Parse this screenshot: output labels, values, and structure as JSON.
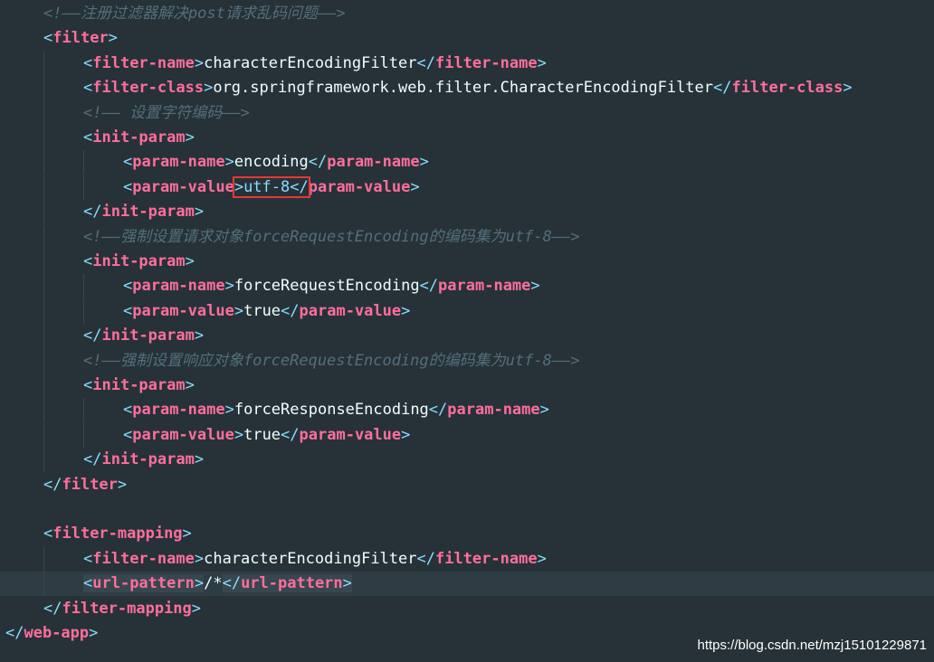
{
  "editor": {
    "lines": [
      {
        "indent": 1,
        "parts": [
          {
            "c": "cmt",
            "t": "<!——注册过滤器解决post请求乱码问题——>"
          }
        ]
      },
      {
        "indent": 1,
        "parts": [
          {
            "c": "br",
            "t": "<"
          },
          {
            "c": "tag",
            "t": "filter"
          },
          {
            "c": "br",
            "t": ">"
          }
        ]
      },
      {
        "indent": 2,
        "parts": [
          {
            "c": "br",
            "t": "<"
          },
          {
            "c": "tag",
            "t": "filter-name"
          },
          {
            "c": "br",
            "t": ">"
          },
          {
            "c": "txt",
            "t": "characterEncodingFilter"
          },
          {
            "c": "br",
            "t": "</"
          },
          {
            "c": "tag",
            "t": "filter-name"
          },
          {
            "c": "br",
            "t": ">"
          }
        ]
      },
      {
        "indent": 2,
        "parts": [
          {
            "c": "br",
            "t": "<"
          },
          {
            "c": "tag",
            "t": "filter-class"
          },
          {
            "c": "br",
            "t": ">"
          },
          {
            "c": "txt",
            "t": "org.springframework.web.filter.CharacterEncodingFilter"
          },
          {
            "c": "br",
            "t": "</"
          },
          {
            "c": "tag",
            "t": "filter-class"
          },
          {
            "c": "br",
            "t": ">"
          }
        ]
      },
      {
        "indent": 2,
        "parts": [
          {
            "c": "cmt",
            "t": "<!—— 设置字符编码——>"
          }
        ]
      },
      {
        "indent": 2,
        "parts": [
          {
            "c": "br",
            "t": "<"
          },
          {
            "c": "tag",
            "t": "init-param"
          },
          {
            "c": "br",
            "t": ">"
          }
        ]
      },
      {
        "indent": 3,
        "parts": [
          {
            "c": "br",
            "t": "<"
          },
          {
            "c": "tag",
            "t": "param-name"
          },
          {
            "c": "br",
            "t": ">"
          },
          {
            "c": "txt",
            "t": "encoding"
          },
          {
            "c": "br",
            "t": "</"
          },
          {
            "c": "tag",
            "t": "param-name"
          },
          {
            "c": "br",
            "t": ">"
          }
        ]
      },
      {
        "indent": 3,
        "parts": [
          {
            "c": "br",
            "t": "<"
          },
          {
            "c": "tag",
            "t": "param-value"
          },
          {
            "c": "br hl",
            "t": ">utf-8</"
          },
          {
            "c": "tag",
            "t": "param-value"
          },
          {
            "c": "br",
            "t": ">"
          }
        ]
      },
      {
        "indent": 2,
        "parts": [
          {
            "c": "br",
            "t": "</"
          },
          {
            "c": "tag",
            "t": "init-param"
          },
          {
            "c": "br",
            "t": ">"
          }
        ]
      },
      {
        "indent": 2,
        "parts": [
          {
            "c": "cmt",
            "t": "<!——强制设置请求对象forceRequestEncoding的编码集为utf-8——>"
          }
        ]
      },
      {
        "indent": 2,
        "parts": [
          {
            "c": "br",
            "t": "<"
          },
          {
            "c": "tag",
            "t": "init-param"
          },
          {
            "c": "br",
            "t": ">"
          }
        ]
      },
      {
        "indent": 3,
        "parts": [
          {
            "c": "br",
            "t": "<"
          },
          {
            "c": "tag",
            "t": "param-name"
          },
          {
            "c": "br",
            "t": ">"
          },
          {
            "c": "txt",
            "t": "forceRequestEncoding"
          },
          {
            "c": "br",
            "t": "</"
          },
          {
            "c": "tag",
            "t": "param-name"
          },
          {
            "c": "br",
            "t": ">"
          }
        ]
      },
      {
        "indent": 3,
        "parts": [
          {
            "c": "br",
            "t": "<"
          },
          {
            "c": "tag",
            "t": "param-value"
          },
          {
            "c": "br",
            "t": ">"
          },
          {
            "c": "txt",
            "t": "true"
          },
          {
            "c": "br",
            "t": "</"
          },
          {
            "c": "tag",
            "t": "param-value"
          },
          {
            "c": "br",
            "t": ">"
          }
        ]
      },
      {
        "indent": 2,
        "parts": [
          {
            "c": "br",
            "t": "</"
          },
          {
            "c": "tag",
            "t": "init-param"
          },
          {
            "c": "br",
            "t": ">"
          }
        ]
      },
      {
        "indent": 2,
        "parts": [
          {
            "c": "cmt",
            "t": "<!——强制设置响应对象forceRequestEncoding的编码集为utf-8——>"
          }
        ]
      },
      {
        "indent": 2,
        "parts": [
          {
            "c": "br",
            "t": "<"
          },
          {
            "c": "tag",
            "t": "init-param"
          },
          {
            "c": "br",
            "t": ">"
          }
        ]
      },
      {
        "indent": 3,
        "parts": [
          {
            "c": "br",
            "t": "<"
          },
          {
            "c": "tag",
            "t": "param-name"
          },
          {
            "c": "br",
            "t": ">"
          },
          {
            "c": "txt",
            "t": "forceResponseEncoding"
          },
          {
            "c": "br",
            "t": "</"
          },
          {
            "c": "tag",
            "t": "param-name"
          },
          {
            "c": "br",
            "t": ">"
          }
        ]
      },
      {
        "indent": 3,
        "parts": [
          {
            "c": "br",
            "t": "<"
          },
          {
            "c": "tag",
            "t": "param-value"
          },
          {
            "c": "br",
            "t": ">"
          },
          {
            "c": "txt",
            "t": "true"
          },
          {
            "c": "br",
            "t": "</"
          },
          {
            "c": "tag",
            "t": "param-value"
          },
          {
            "c": "br",
            "t": ">"
          }
        ]
      },
      {
        "indent": 2,
        "parts": [
          {
            "c": "br",
            "t": "</"
          },
          {
            "c": "tag",
            "t": "init-param"
          },
          {
            "c": "br",
            "t": ">"
          }
        ]
      },
      {
        "indent": 1,
        "parts": [
          {
            "c": "br",
            "t": "</"
          },
          {
            "c": "tag",
            "t": "filter"
          },
          {
            "c": "br",
            "t": ">"
          }
        ]
      },
      {
        "indent": 0,
        "parts": []
      },
      {
        "indent": 1,
        "parts": [
          {
            "c": "br",
            "t": "<"
          },
          {
            "c": "tag",
            "t": "filter-mapping"
          },
          {
            "c": "br",
            "t": ">"
          }
        ]
      },
      {
        "indent": 2,
        "parts": [
          {
            "c": "br",
            "t": "<"
          },
          {
            "c": "tag",
            "t": "filter-name"
          },
          {
            "c": "br",
            "t": ">"
          },
          {
            "c": "txt",
            "t": "characterEncodingFilter"
          },
          {
            "c": "br",
            "t": "</"
          },
          {
            "c": "tag",
            "t": "filter-name"
          },
          {
            "c": "br",
            "t": ">"
          }
        ]
      },
      {
        "indent": 2,
        "current": true,
        "parts": [
          {
            "c": "br m",
            "t": "<"
          },
          {
            "c": "tag m",
            "t": "url-pattern"
          },
          {
            "c": "br m",
            "t": ">"
          },
          {
            "c": "txt",
            "t": "/*"
          },
          {
            "c": "br m",
            "t": "</"
          },
          {
            "c": "tag m",
            "t": "url-pattern"
          },
          {
            "c": "br m",
            "t": ">"
          }
        ]
      },
      {
        "indent": 1,
        "parts": [
          {
            "c": "br",
            "t": "</"
          },
          {
            "c": "tag",
            "t": "filter-mapping"
          },
          {
            "c": "br",
            "t": ">"
          }
        ]
      },
      {
        "indent": 0,
        "parts": [
          {
            "c": "br",
            "t": "</"
          },
          {
            "c": "tag",
            "t": "web-app"
          },
          {
            "c": "br",
            "t": ">"
          }
        ]
      }
    ]
  },
  "watermark": "https://blog.csdn.net/mzj15101229871",
  "colors": {
    "background": "#263238",
    "bracket": "#89DDFF",
    "tag": "#FF6E9C",
    "text": "#EEFFFF",
    "comment": "#546E7A",
    "highlight_box": "#E53935"
  }
}
